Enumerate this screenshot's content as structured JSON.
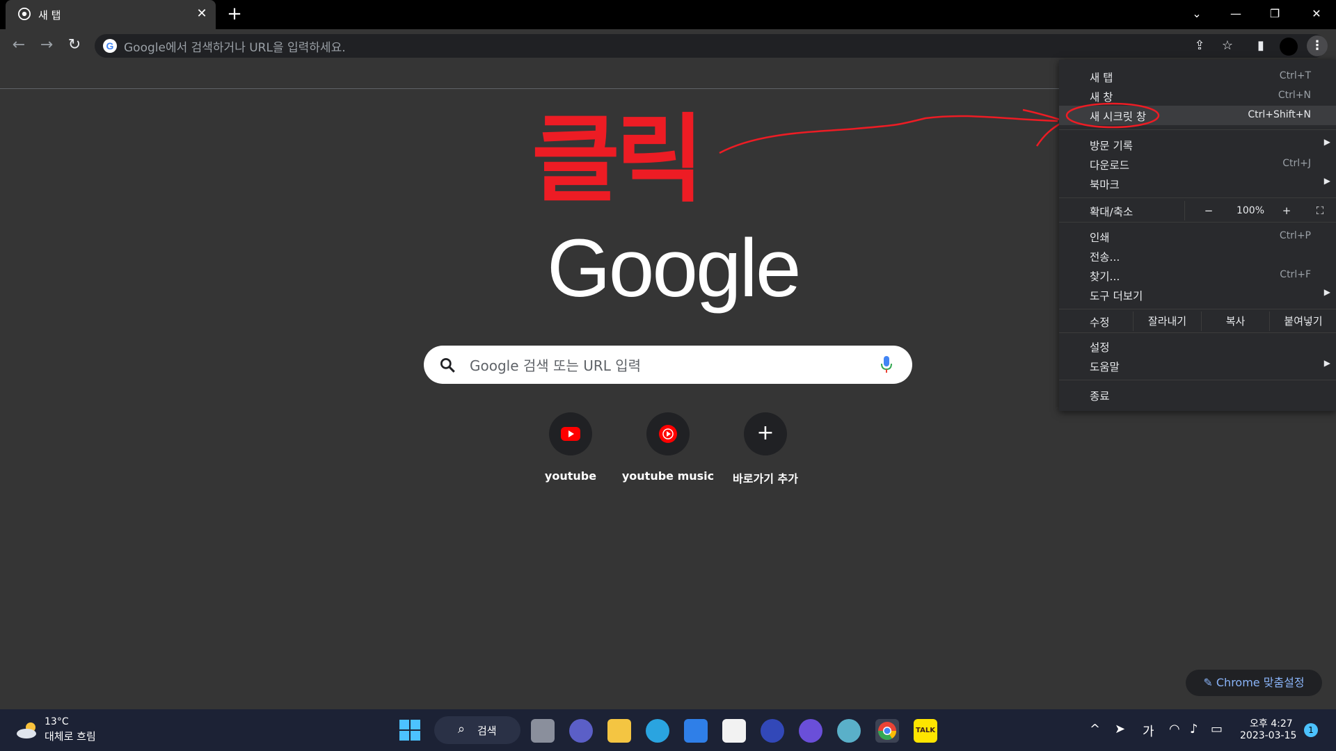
{
  "tab": {
    "title": "새 탭"
  },
  "omnibox": {
    "placeholder": "Google에서 검색하거나 URL을 입력하세요."
  },
  "annotation": {
    "text": "클릭"
  },
  "google": {
    "logo_text": "Google",
    "search_placeholder": "Google 검색 또는 URL 입력"
  },
  "shortcuts": [
    {
      "label": "youtube",
      "icon": "youtube-icon"
    },
    {
      "label": "youtube music",
      "icon": "youtube-music-icon"
    },
    {
      "label": "바로가기 추가",
      "icon": "plus-icon"
    }
  ],
  "customize": {
    "label": "Chrome 맞춤설정"
  },
  "menu": {
    "new_tab": {
      "label": "새 탭",
      "shortcut": "Ctrl+T"
    },
    "new_window": {
      "label": "새 창",
      "shortcut": "Ctrl+N"
    },
    "new_incognito": {
      "label": "새 시크릿 창",
      "shortcut": "Ctrl+Shift+N"
    },
    "history": {
      "label": "방문 기록"
    },
    "downloads": {
      "label": "다운로드",
      "shortcut": "Ctrl+J"
    },
    "bookmarks": {
      "label": "북마크"
    },
    "zoom": {
      "label": "확대/축소",
      "minus": "−",
      "value": "100%",
      "plus": "+"
    },
    "print": {
      "label": "인쇄",
      "shortcut": "Ctrl+P"
    },
    "cast": {
      "label": "전송..."
    },
    "find": {
      "label": "찾기...",
      "shortcut": "Ctrl+F"
    },
    "more_tools": {
      "label": "도구 더보기"
    },
    "edit": {
      "label": "수정",
      "cut": "잘라내기",
      "copy": "복사",
      "paste": "붙여넣기"
    },
    "settings": {
      "label": "설정"
    },
    "help": {
      "label": "도움말"
    },
    "exit": {
      "label": "종료"
    }
  },
  "taskbar": {
    "weather_temp": "13°C",
    "weather_desc": "대체로 흐림",
    "search_label": "검색",
    "ime": "가",
    "time": "오후 4:27",
    "date": "2023-03-15",
    "notifications": "1"
  },
  "colors": {
    "annotation": "#ed1c24",
    "background": "#353535",
    "menu_bg": "#292a2d"
  }
}
